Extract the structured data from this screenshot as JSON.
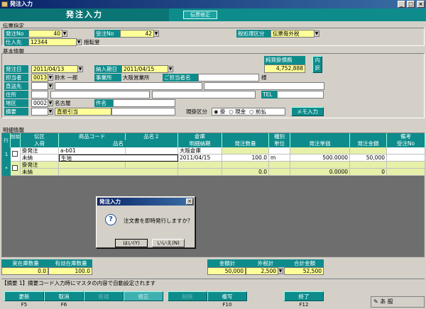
{
  "window": {
    "title": "発注入力",
    "screen_title": "発注入力",
    "mode_badge": "伝票修正"
  },
  "slip": {
    "section": "伝票指定",
    "order_no_label": "発注No",
    "order_no": "40",
    "receive_no_label": "受注No",
    "receive_no": "42",
    "tax_label": "税処理区分",
    "tax_value": "伝票毎外税",
    "supplier_label": "仕入先",
    "supplier_code": "12344",
    "supplier_name": "揺転堂"
  },
  "basic": {
    "section": "基本情報",
    "order_date_label": "発注日",
    "order_date": "2011/04/13",
    "delivery_label": "納入期日",
    "delivery_date": "2011/04/15",
    "staff_label": "担当者",
    "staff_code": "0013",
    "staff_name": "鈴木 一郎",
    "office_label": "事業所",
    "office_name": "大阪営業所",
    "person_label": "ご担当者名",
    "honorific": "様",
    "dest_label": "直送先",
    "address_label": "住所",
    "tel_label": "TEL",
    "area_label": "地区",
    "area_code": "0002",
    "area_name": "名古屋",
    "subject_label": "件名",
    "note_label": "摘要",
    "note_value": "直振引当",
    "cash_label": "現掛区分",
    "cash_options": [
      "掛",
      "現金",
      "前払"
    ],
    "memo_button": "メモ入力",
    "payable_label": "純買掛債務",
    "payable_value": "4,752,888",
    "detail_button": "内訳"
  },
  "details": {
    "section": "明細情報",
    "headers_top": [
      "行No",
      "削除",
      "伝区",
      "商品コード",
      "品名２",
      "倉庫",
      "",
      "種別",
      "",
      "",
      "備考"
    ],
    "headers_bottom": [
      "入荷",
      "品名",
      "明細納期",
      "発注数量",
      "単位",
      "発注単価",
      "発注金額",
      "受注No"
    ],
    "rows": [
      {
        "row_no": "1",
        "kind": "掛発注",
        "status": "未納",
        "code": "a-b01",
        "name": "生地",
        "warehouse": "大阪倉庫",
        "date": "2011/04/15",
        "qty": "100.0",
        "unit": "m",
        "price": "500.0000",
        "amount": "50,000"
      },
      {
        "row_no": "2",
        "kind": "掛発注",
        "status": "未納",
        "code": "",
        "name": "",
        "warehouse": "",
        "date": "",
        "qty": "0.0",
        "unit": "",
        "price": "0.0000",
        "amount": "0"
      }
    ]
  },
  "dialog": {
    "title": "発注入力",
    "message": "注文書を即時発行しますか？",
    "yes": "はい(Y)",
    "no": "いいえ(N)"
  },
  "totals": {
    "stock_label": "実在庫数量",
    "stock_value": "0.0",
    "valid_label": "有効在庫数量",
    "valid_value": "100.0",
    "amount_label": "金額計",
    "amount_value": "50,000",
    "tax_label": "外税計",
    "tax_value": "2,500",
    "total_label": "合計金額",
    "total_value": "52,500"
  },
  "hint": "【摘要 1】摘要コード入力時にマスタの内容で自動設定されます",
  "fkeys": [
    {
      "label": "更新",
      "key": "F5"
    },
    {
      "label": "取消",
      "key": "F6"
    },
    {
      "label": "新規",
      "key": ""
    },
    {
      "label": "修正",
      "key": ""
    },
    {
      "label": "削除",
      "key": ""
    },
    {
      "label": "複写",
      "key": "F10"
    },
    {
      "label": "終了",
      "key": "F12"
    }
  ],
  "ime": "あ 般",
  "colors": {
    "accent": "#0e8c8c",
    "highlight": "#ffff99"
  }
}
